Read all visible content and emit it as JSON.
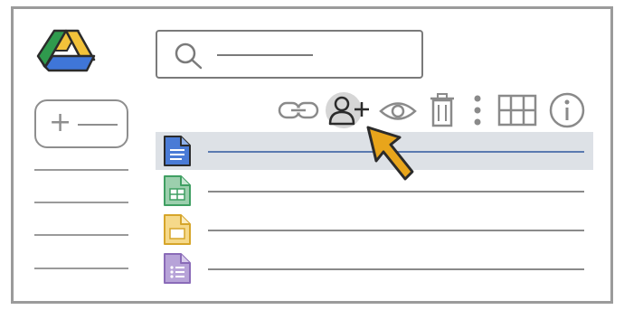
{
  "app": {
    "name": "Google Drive"
  },
  "search": {
    "placeholder": ""
  },
  "sidebar": {
    "new_button": {
      "symbol": "+",
      "label": ""
    },
    "items": [
      {
        "label": ""
      },
      {
        "label": ""
      },
      {
        "label": ""
      },
      {
        "label": ""
      }
    ]
  },
  "toolbar": {
    "items": [
      {
        "icon": "link-icon"
      },
      {
        "icon": "share-user-icon",
        "highlighted": true
      },
      {
        "icon": "preview-eye-icon"
      },
      {
        "icon": "trash-icon"
      },
      {
        "icon": "more-vertical-icon"
      },
      {
        "icon": "grid-view-icon"
      },
      {
        "icon": "info-icon"
      }
    ]
  },
  "files": [
    {
      "type": "document",
      "icon": "google-docs-icon",
      "color": "#4a7bd6",
      "name": "",
      "selected": true
    },
    {
      "type": "spreadsheet",
      "icon": "google-sheets-icon",
      "color": "#3f9f62",
      "name": "",
      "selected": false
    },
    {
      "type": "presentation",
      "icon": "google-slides-icon",
      "color": "#e8b93c",
      "name": "",
      "selected": false
    },
    {
      "type": "form",
      "icon": "google-forms-icon",
      "color": "#8a6bb8",
      "name": "",
      "selected": false
    }
  ],
  "colors": {
    "drive_green": "#2f9a4d",
    "drive_yellow": "#f2c23a",
    "drive_blue": "#3f76d8",
    "selection_bg": "#dde1e6",
    "cursor_fill": "#e8a51b"
  }
}
